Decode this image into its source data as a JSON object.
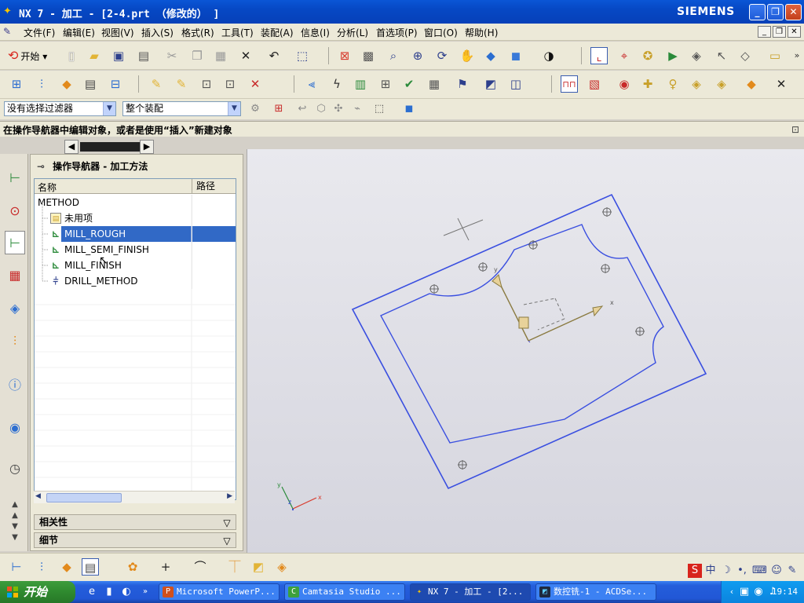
{
  "window": {
    "title": "NX 7 - 加工 - [2-4.prt （修改的） ]",
    "brand": "SIEMENS",
    "minimize_label": "_",
    "maximize_label": "❐",
    "close_label": "✕"
  },
  "menu": {
    "items": [
      "文件(F)",
      "编辑(E)",
      "视图(V)",
      "插入(S)",
      "格式(R)",
      "工具(T)",
      "装配(A)",
      "信息(I)",
      "分析(L)",
      "首选项(P)",
      "窗口(O)",
      "帮助(H)"
    ]
  },
  "toolbar": {
    "start_label": "开始"
  },
  "filter": {
    "selection_filter": "没有选择过滤器",
    "assembly_scope": "整个装配"
  },
  "status": {
    "prompt": "在操作导航器中编辑对象，或者是使用“插入”新建对象"
  },
  "navigator": {
    "title": "操作导航器 - 加工方法",
    "columns": {
      "name": "名称",
      "path": "路径"
    },
    "rows": [
      {
        "label": "METHOD"
      },
      {
        "label": "未用项"
      },
      {
        "label": "MILL_ROUGH"
      },
      {
        "label": "MILL_SEMI_FINISH"
      },
      {
        "label": "MILL_FINISH"
      },
      {
        "label": "DRILL_METHOD"
      }
    ],
    "selected_index": 2,
    "sections": {
      "dependencies": "相关性",
      "details": "细节"
    }
  },
  "taskbar": {
    "start_label": "开始",
    "tasks": [
      {
        "label": "Microsoft PowerP..."
      },
      {
        "label": "Camtasia Studio ..."
      },
      {
        "label": "NX 7 - 加工 - [2..."
      },
      {
        "label": "数控铣-1 - ACDSe..."
      }
    ],
    "active_index": 2,
    "clock": "19:14"
  },
  "colors": {
    "titlebar": "#0a56d6",
    "selection": "#3169c6",
    "geometry": "#3a4fe0"
  },
  "icons": {
    "app": "nx-logo-icon",
    "filter": "funnel-icon",
    "tray": "speaker-icon"
  }
}
